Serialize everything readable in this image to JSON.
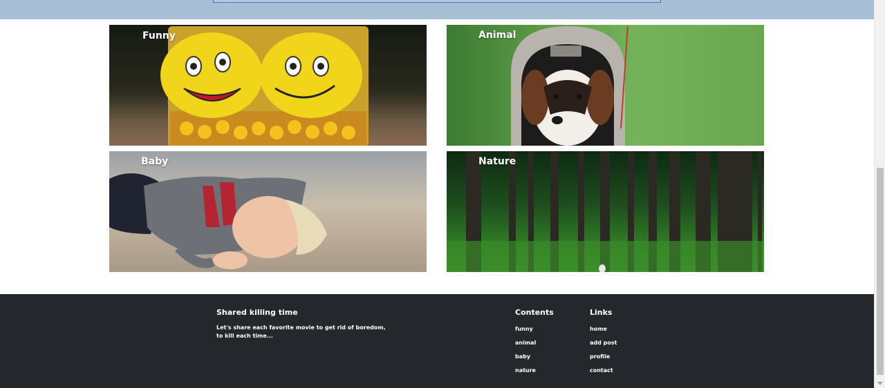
{
  "categories": [
    {
      "label": "Funny"
    },
    {
      "label": "Animal"
    },
    {
      "label": "Baby"
    },
    {
      "label": "Nature"
    }
  ],
  "footer": {
    "about": {
      "title": "Shared killing time",
      "text": "Let's share each favorite movie to get rid of boredom, to kill each time..."
    },
    "contents": {
      "title": "Contents",
      "items": [
        "funny",
        "animal",
        "baby",
        "nature"
      ]
    },
    "links": {
      "title": "Links",
      "items": [
        "home",
        "add post",
        "profile",
        "contact"
      ]
    }
  },
  "colors": {
    "footer_bg": "#24282c",
    "top_strip": "#a9bfd6",
    "input_border": "#3b6fd6"
  }
}
